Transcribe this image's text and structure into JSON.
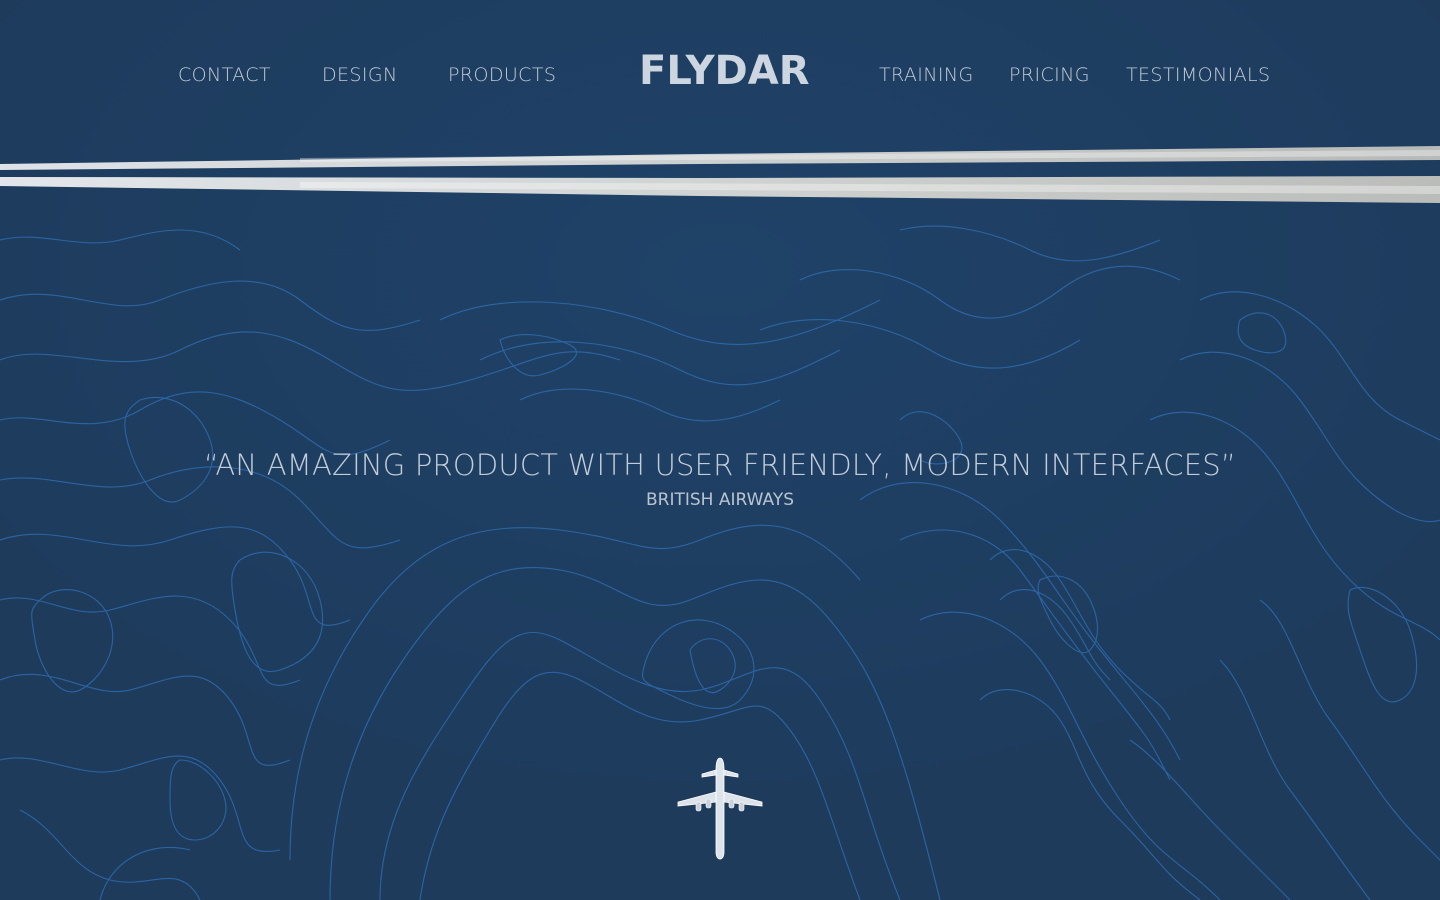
{
  "brand": {
    "logo_text": "FLYDAR"
  },
  "nav": {
    "left": [
      {
        "label": "CONTACT"
      },
      {
        "label": "DESIGN"
      },
      {
        "label": "PRODUCTS"
      }
    ],
    "right": [
      {
        "label": "TRAINING"
      },
      {
        "label": "PRICING"
      },
      {
        "label": "TESTIMONIALS"
      }
    ]
  },
  "testimonial": {
    "quote": "“AN AMAZING PRODUCT WITH USER FRIENDLY, MODERN INTERFACES”",
    "source": "BRITISH AIRWAYS"
  },
  "icons": {
    "contrail": "contrail-graphic",
    "plane": "airplane-icon",
    "map": "topographic-contour-map"
  },
  "colors": {
    "background": "#1f3d5f",
    "contour_lines": "#2f6fb6",
    "text": "#c9d3df"
  }
}
